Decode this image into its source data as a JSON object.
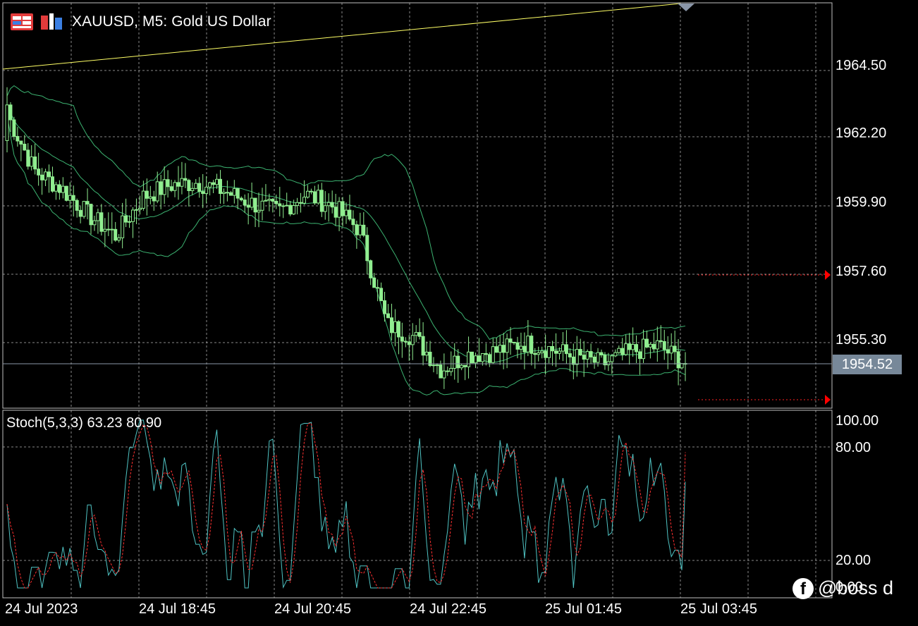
{
  "window": {
    "title": "XAUUSD, M5:  Gold US Dollar",
    "icons": [
      "calendar-grid-icon",
      "chart-type-icon"
    ]
  },
  "price_axis": {
    "labels": [
      "1964.50",
      "1962.20",
      "1959.90",
      "1957.60",
      "1955.30"
    ],
    "current_price": "1954.52"
  },
  "stoch_panel": {
    "label": "Stoch(5,3,3) 63.23 80.90",
    "levels": [
      "100.00",
      "80.00",
      "20.00",
      "0.00"
    ]
  },
  "time_axis": {
    "labels": [
      "24 Jul 2023",
      "24 Jul 18:45",
      "24 Jul 20:45",
      "24 Jul 22:45",
      "25 Jul 01:45",
      "25 Jul 03:45"
    ]
  },
  "watermark": {
    "text": "@boss d",
    "icon": "facebook-icon"
  },
  "colors": {
    "background": "#000000",
    "grid": "#c0c0c0",
    "candle": "#90ee90",
    "bollinger": "#3cb371",
    "trendline": "#ffff66",
    "stoch_main": "#4fc3c3",
    "stoch_signal": "#ff3030",
    "current_price_bg": "#778899",
    "alert_marker": "#ff0000"
  },
  "chart_data": {
    "type": "candlestick",
    "symbol": "XAUUSD",
    "timeframe": "M5",
    "ylim": [
      1953.4,
      1966.5
    ],
    "current_price": 1954.52,
    "alert_levels": [
      1957.5,
      1953.4
    ],
    "bars_sample_close": [
      1962.9,
      1961.0,
      1960.4,
      1959.5,
      1958.8,
      1960.1,
      1960.5,
      1960.6,
      1960.3,
      1959.9,
      1959.6,
      1960.2,
      1959.8,
      1959.0,
      1955.8,
      1955.4,
      1954.3,
      1954.8,
      1954.9,
      1955.2,
      1955.0,
      1954.7,
      1954.5,
      1954.9,
      1955.1,
      1954.52
    ],
    "stochastic": {
      "name": "Stoch(5,3,3)",
      "main": 63.23,
      "signal": 80.9,
      "ylim": [
        0,
        100
      ],
      "levels": [
        20,
        80
      ]
    }
  }
}
